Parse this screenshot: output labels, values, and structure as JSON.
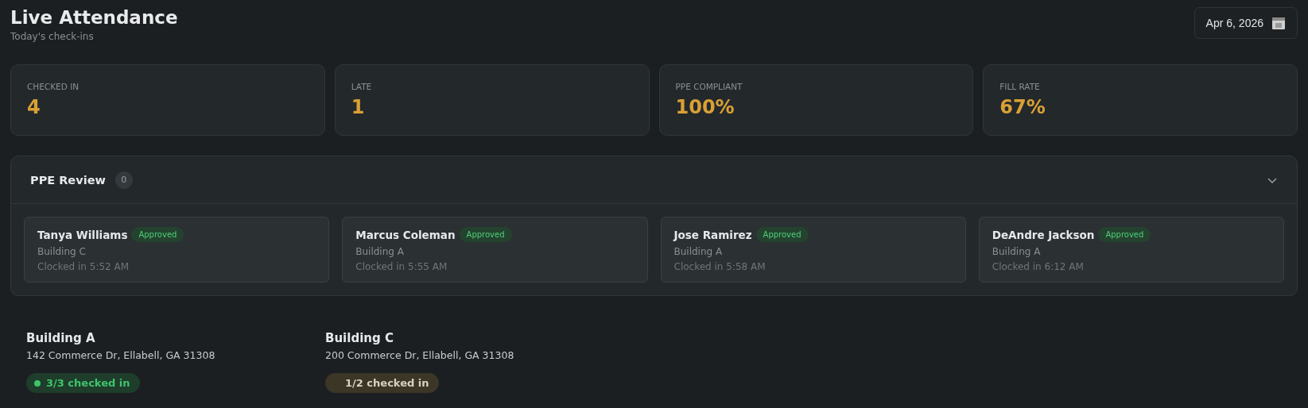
{
  "header": {
    "title": "Live Attendance",
    "subtitle": "Today's check-ins",
    "date": "Apr 6, 2026"
  },
  "stats": [
    {
      "label": "CHECKED IN",
      "value": "4"
    },
    {
      "label": "LATE",
      "value": "1"
    },
    {
      "label": "PPE COMPLIANT",
      "value": "100%"
    },
    {
      "label": "FILL RATE",
      "value": "67%"
    }
  ],
  "ppe_review": {
    "title": "PPE Review",
    "count": "0",
    "expanded": true,
    "workers": [
      {
        "name": "Tanya Williams",
        "status": "Approved",
        "building": "Building C",
        "clocked": "Clocked in 5:52 AM"
      },
      {
        "name": "Marcus Coleman",
        "status": "Approved",
        "building": "Building A",
        "clocked": "Clocked in 5:55 AM"
      },
      {
        "name": "Jose Ramirez",
        "status": "Approved",
        "building": "Building A",
        "clocked": "Clocked in 5:58 AM"
      },
      {
        "name": "DeAndre Jackson",
        "status": "Approved",
        "building": "Building A",
        "clocked": "Clocked in 6:12 AM"
      }
    ]
  },
  "buildings": [
    {
      "name": "Building A",
      "address": "142 Commerce Dr, Ellabell, GA 31308",
      "checked_in": "3/3 checked in",
      "kind": "full"
    },
    {
      "name": "Building C",
      "address": "200 Commerce Dr, Ellabell, GA 31308",
      "checked_in": "1/2 checked in",
      "kind": "partial"
    }
  ]
}
